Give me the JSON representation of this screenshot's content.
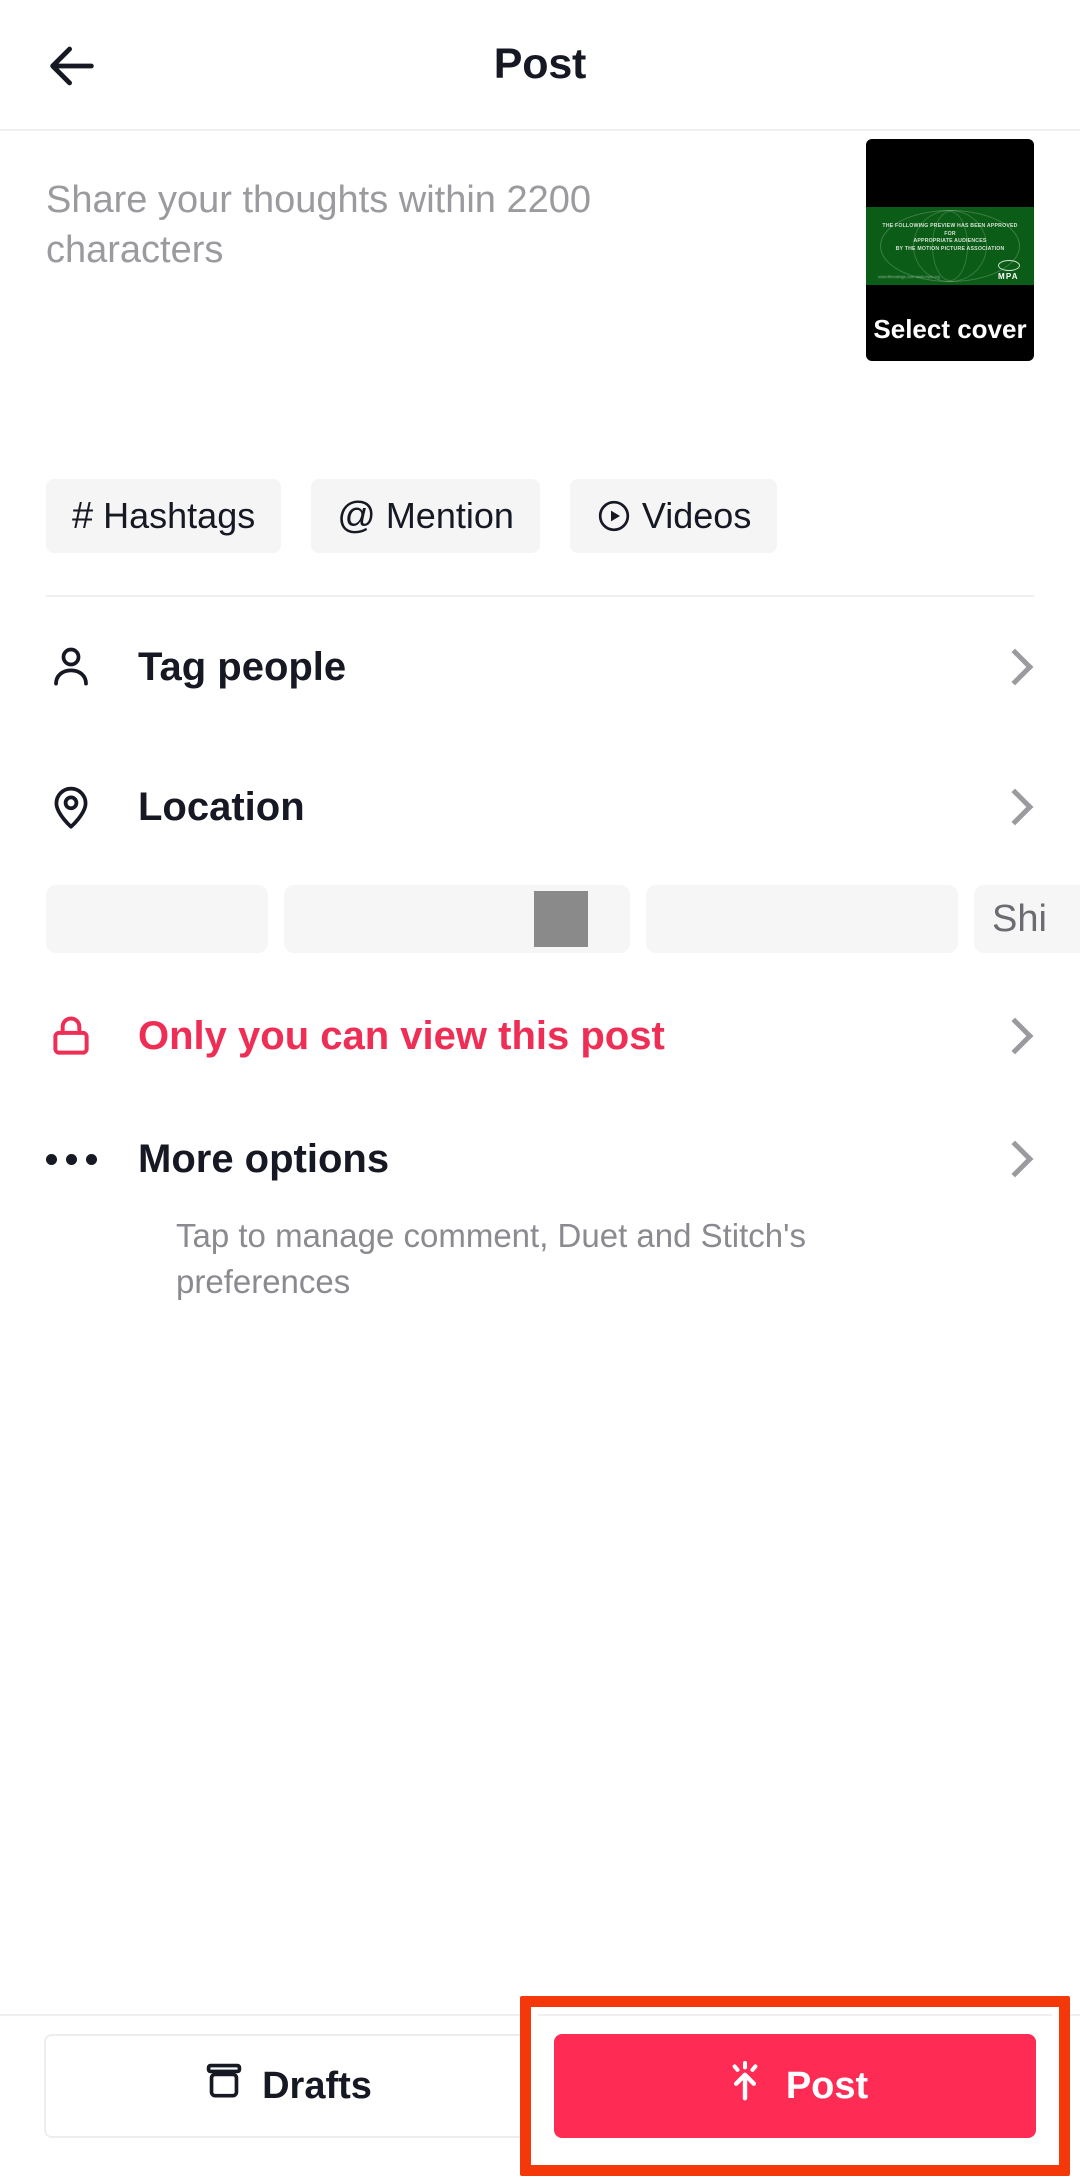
{
  "header": {
    "title": "Post",
    "back_icon": "arrow-left-icon"
  },
  "caption": {
    "placeholder": "Share your thoughts within 2200 characters",
    "max_characters": "2200"
  },
  "cover": {
    "select_cover_label": "Select cover",
    "band_line1": "THE FOLLOWING PREVIEW HAS BEEN APPROVED FOR",
    "band_line2": "APPROPRIATE AUDIENCES",
    "band_line3": "BY THE MOTION PICTURE ASSOCIATION",
    "band_small": "www.filmratings.com\nwww.mpa.org",
    "band_org": "MPA",
    "band_color": "#0b5c16"
  },
  "chips": [
    {
      "glyph": "#",
      "label": "Hashtags",
      "icon": "hashtag-icon"
    },
    {
      "glyph": "@",
      "label": "Mention",
      "icon": "at-mention-icon"
    },
    {
      "glyph": "▶",
      "label": "Videos",
      "icon": "play-circle-icon"
    }
  ],
  "rows": {
    "tag_people": {
      "label": "Tag people",
      "icon": "person-icon"
    },
    "location": {
      "label": "Location",
      "icon": "location-pin-icon"
    },
    "privacy": {
      "label": "Only you can view this post",
      "icon": "lock-icon",
      "color": "#ee2e55"
    }
  },
  "share_skeleton": {
    "partial_label": "Shi"
  },
  "more_options": {
    "title": "More options",
    "subtitle": "Tap to manage comment, Duet and Stitch's preferences",
    "icon": "ellipsis-icon"
  },
  "bottom": {
    "drafts_label": "Drafts",
    "drafts_icon": "archive-box-icon",
    "post_label": "Post",
    "post_icon": "upload-sparkle-icon",
    "post_color": "#fe2c55",
    "highlight_color": "#f4380a"
  }
}
